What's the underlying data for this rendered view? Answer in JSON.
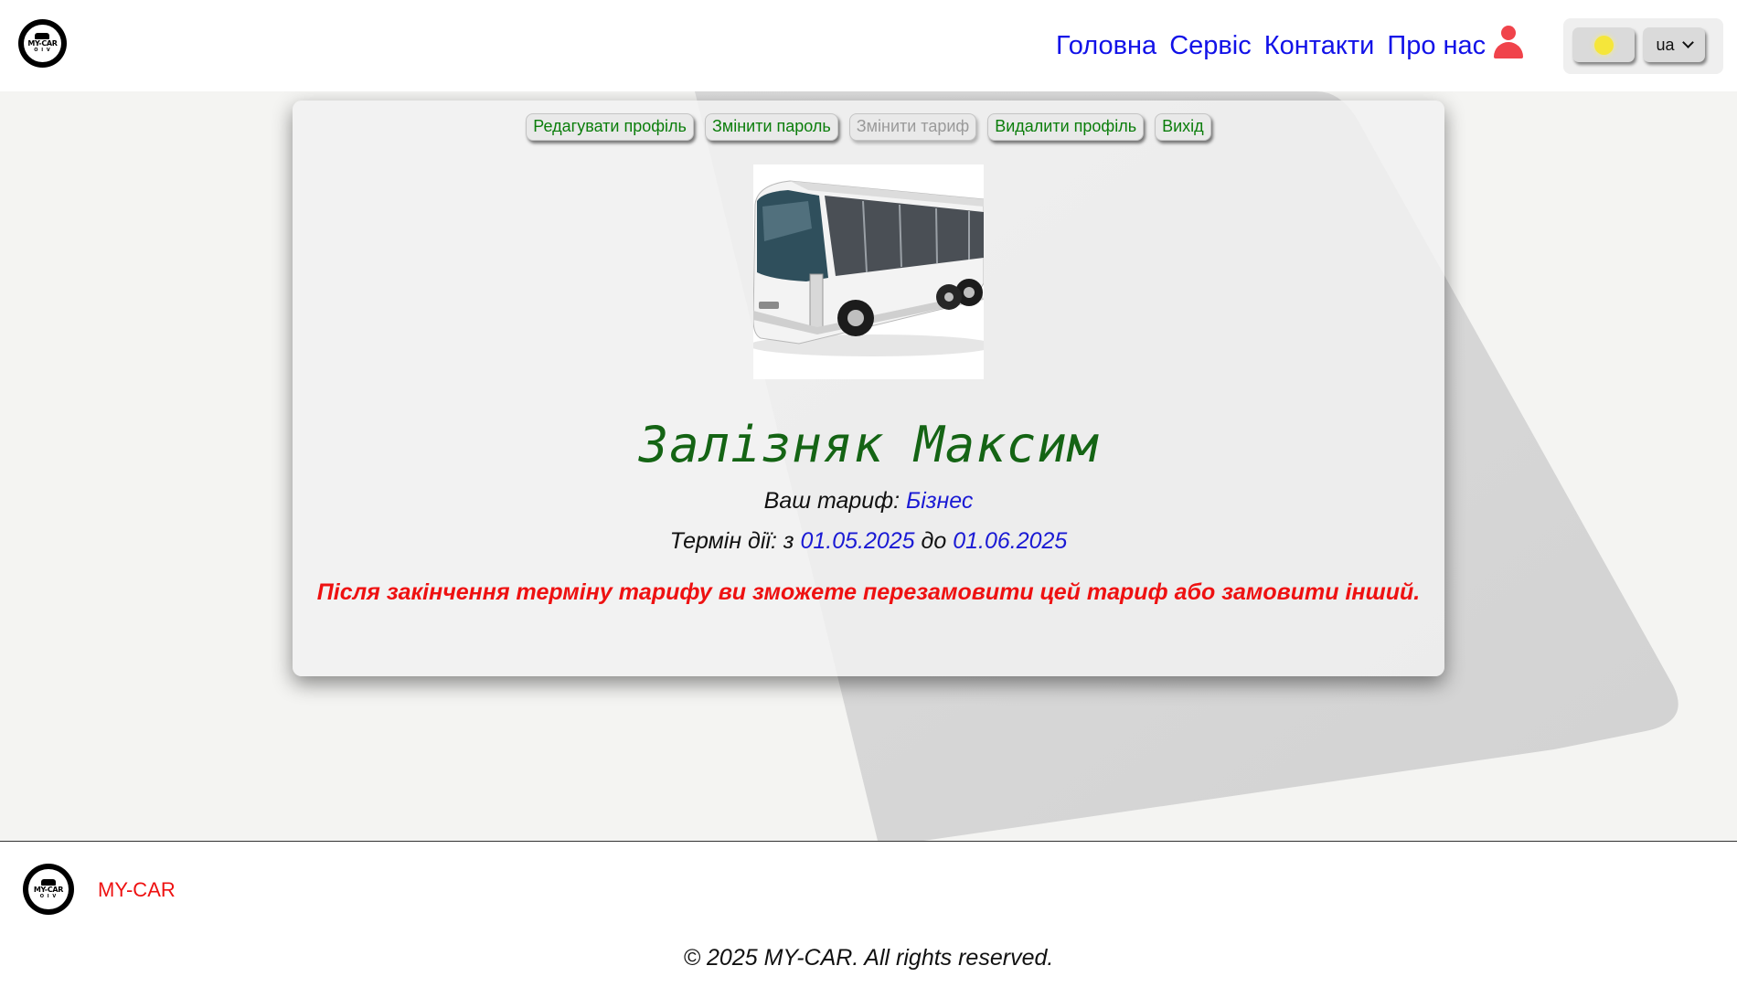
{
  "header": {
    "logo": {
      "text": "MY-CAR",
      "dots": "O I V"
    },
    "nav": [
      "Головна",
      "Сервіс",
      "Контакти",
      "Про нас"
    ],
    "user_icon": "user-icon",
    "theme_icon": "sun-icon",
    "language": {
      "selected": "ua"
    }
  },
  "profile": {
    "toolbar": [
      {
        "label": "Редагувати профіль",
        "enabled": true
      },
      {
        "label": "Змінити пароль",
        "enabled": true
      },
      {
        "label": "Змінити тариф",
        "enabled": false
      },
      {
        "label": "Видалити профіль",
        "enabled": true
      },
      {
        "label": "Вихід",
        "enabled": true
      }
    ],
    "name": "Залізняк Максим",
    "tariff_label": "Ваш тариф:",
    "tariff_value": "Бізнес",
    "term_label": "Термін дії: з",
    "term_from": "01.05.2025",
    "term_to_label": "до",
    "term_to": "01.06.2025",
    "warning": "Після закінчення терміну тарифу ви зможете перезамовити цей тариф або замовити інший."
  },
  "footer": {
    "brand": "MY-CAR",
    "copyright": "© 2025 MY-CAR. All rights reserved."
  },
  "colors": {
    "nav_link": "#1212e8",
    "button_text": "#0a7d0a",
    "name": "#146414",
    "warning": "#ee1111",
    "user_icon": "#f0434b"
  }
}
